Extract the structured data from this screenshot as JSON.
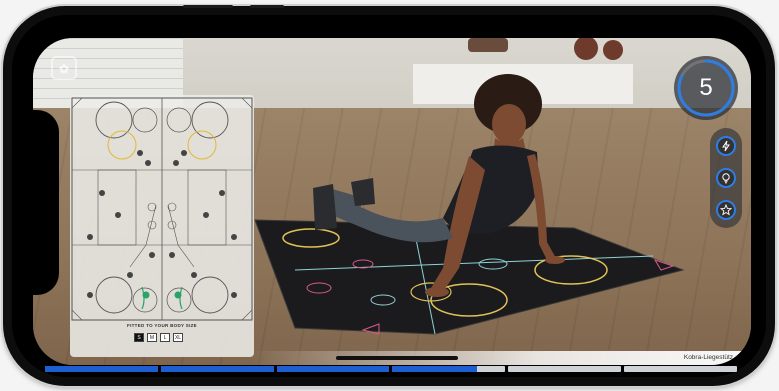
{
  "app": {
    "logo_icon": "app-logo-icon",
    "accent_color": "#2f7de1"
  },
  "counter": {
    "value": "5",
    "progress_fraction": 0.82,
    "ring_color": "#2f7de1"
  },
  "actions": [
    {
      "name": "flash-icon",
      "label": "Energy"
    },
    {
      "name": "lightbulb-icon",
      "label": "Tip"
    },
    {
      "name": "star-icon",
      "label": "Favorite"
    }
  ],
  "guide_card": {
    "size_caption": "FITTED TO YOUR BODY SIZE",
    "sizes": [
      "S",
      "M",
      "L",
      "XL"
    ],
    "selected_size": "S"
  },
  "exercise": {
    "name": "Kobra-Liegestütz"
  },
  "progress_segments": [
    1,
    1,
    1,
    0.75,
    0,
    0
  ]
}
